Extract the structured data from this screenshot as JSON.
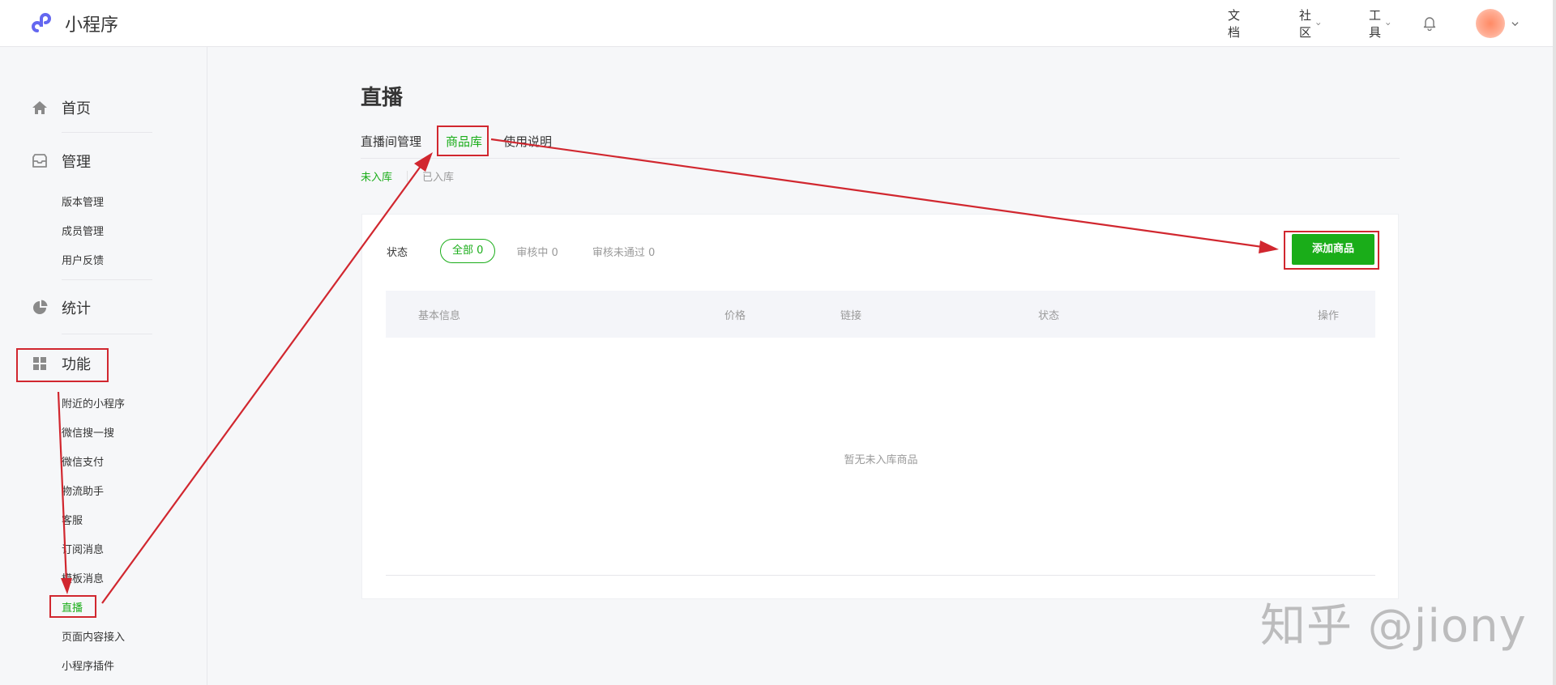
{
  "header": {
    "app_name": "小程序",
    "nav": [
      {
        "label": "文档"
      },
      {
        "label": "社区"
      },
      {
        "label": "工具"
      }
    ]
  },
  "sidebar": {
    "home": "首页",
    "manage": "管理",
    "manage_items": [
      "版本管理",
      "成员管理",
      "用户反馈"
    ],
    "stats": "统计",
    "features": "功能",
    "feature_items": [
      "附近的小程序",
      "微信搜一搜",
      "微信支付",
      "物流助手",
      "客服",
      "订阅消息",
      "模板消息",
      "直播",
      "页面内容接入",
      "小程序插件"
    ],
    "active_item": "直播"
  },
  "main": {
    "title": "直播",
    "tabs": [
      "直播间管理",
      "商品库",
      "使用说明"
    ],
    "active_tab": "商品库",
    "subtabs": [
      "未入库",
      "已入库"
    ],
    "active_subtab": "未入库",
    "filter_label": "状态",
    "filters": [
      "全部 0",
      "审核中 0",
      "审核未通过 0"
    ],
    "add_button": "添加商品",
    "columns": [
      "基本信息",
      "价格",
      "链接",
      "状态",
      "操作"
    ],
    "empty_text": "暂无未入库商品"
  },
  "watermark": "知乎 @jiony",
  "colors": {
    "accent": "#1aad19",
    "annotation": "#d1272f"
  },
  "icons": [
    "logo-icon",
    "home-icon",
    "inbox-icon",
    "pie-chart-icon",
    "grid-icon",
    "bell-icon",
    "chevron-down-icon"
  ]
}
